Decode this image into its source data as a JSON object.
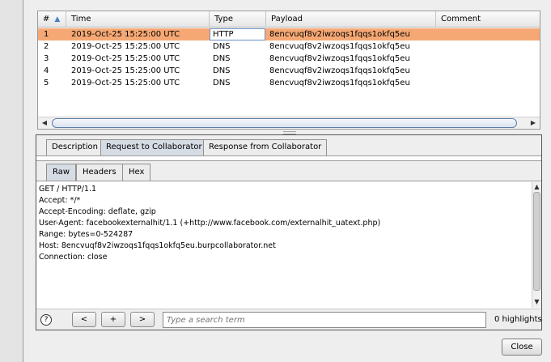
{
  "table": {
    "columns": [
      "#",
      "Time",
      "Type",
      "Payload",
      "Comment"
    ],
    "rows": [
      {
        "num": "1",
        "time": "2019-Oct-25 15:25:00 UTC",
        "type": "HTTP",
        "payload": "8encvuqf8v2iwzoqs1fqqs1okfq5eu",
        "comment": ""
      },
      {
        "num": "2",
        "time": "2019-Oct-25 15:25:00 UTC",
        "type": "DNS",
        "payload": "8encvuqf8v2iwzoqs1fqqs1okfq5eu",
        "comment": ""
      },
      {
        "num": "3",
        "time": "2019-Oct-25 15:25:00 UTC",
        "type": "DNS",
        "payload": "8encvuqf8v2iwzoqs1fqqs1okfq5eu",
        "comment": ""
      },
      {
        "num": "4",
        "time": "2019-Oct-25 15:25:00 UTC",
        "type": "DNS",
        "payload": "8encvuqf8v2iwzoqs1fqqs1okfq5eu",
        "comment": ""
      },
      {
        "num": "5",
        "time": "2019-Oct-25 15:25:00 UTC",
        "type": "DNS",
        "payload": "8encvuqf8v2iwzoqs1fqqs1okfq5eu",
        "comment": ""
      }
    ],
    "selected_color": "#f6a874"
  },
  "tabs": [
    "Description",
    "Request to Collaborator",
    "Response from Collaborator"
  ],
  "subtabs": [
    "Raw",
    "Headers",
    "Hex"
  ],
  "request_lines": [
    "GET / HTTP/1.1",
    "Accept: */*",
    "Accept-Encoding: deflate, gzip",
    "User-Agent: facebookexternalhit/1.1 (+http://www.facebook.com/externalhit_uatext.php)",
    "Range: bytes=0-524287",
    "Host: 8encvuqf8v2iwzoqs1fqqs1okfq5eu.burpcollaborator.net",
    "Connection: close"
  ],
  "bottom": {
    "help": "?",
    "prev": "<",
    "add": "+",
    "next": ">",
    "search_placeholder": "Type a search term",
    "highlights": "0 highlights"
  },
  "close_label": "Close"
}
